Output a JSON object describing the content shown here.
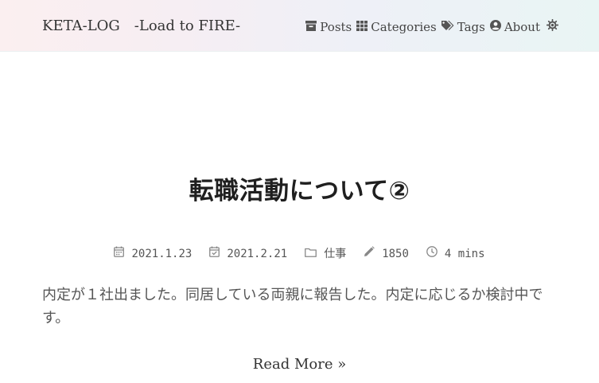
{
  "site": {
    "brand": "KETA-LOG　-Load to FIRE-"
  },
  "nav": {
    "items": [
      {
        "label": "Posts",
        "icon": "archive-icon"
      },
      {
        "label": "Categories",
        "icon": "grid-icon"
      },
      {
        "label": "Tags",
        "icon": "tags-icon"
      },
      {
        "label": "About",
        "icon": "user-circle-icon"
      }
    ],
    "theme_icon": "sun-icon"
  },
  "post": {
    "title": "転職活動について②",
    "meta": {
      "published": "2021.1.23",
      "updated": "2021.2.21",
      "category": "仕事",
      "words": "1850",
      "reading_time": "4 mins"
    },
    "summary": "内定が１社出ました。同居している両親に報告した。内定に応じるか検討中です。",
    "read_more": "Read More »"
  },
  "colors": {
    "header_gradient_start": "#fbeff0",
    "header_gradient_end": "#e9f5f4",
    "title": "#1f1f1f",
    "text": "#555555"
  }
}
